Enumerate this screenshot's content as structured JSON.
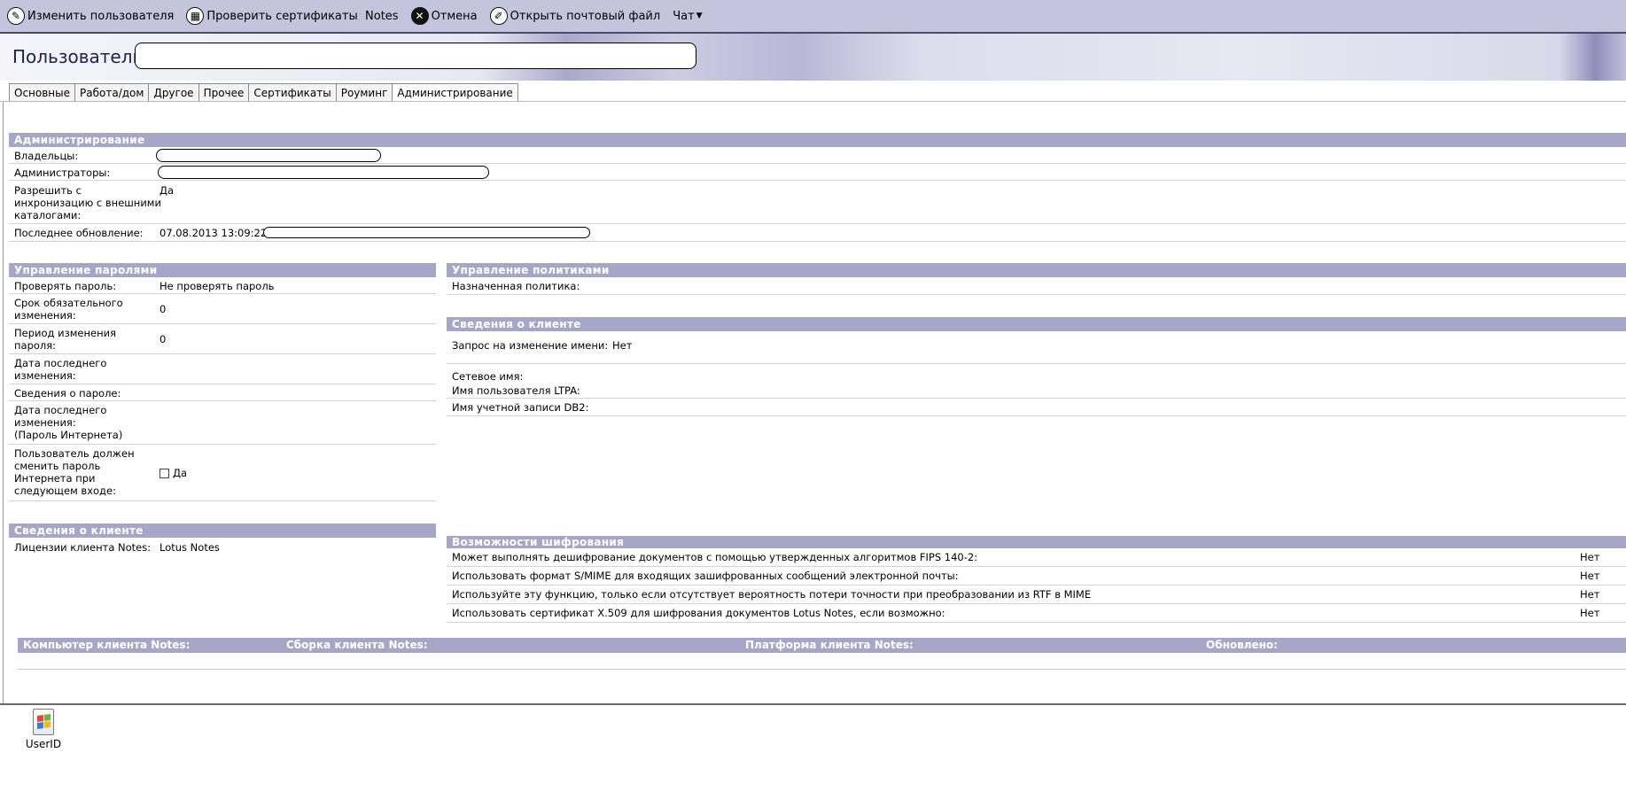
{
  "toolbar": {
    "edit_user": "Изменить пользователя",
    "check_certs": "Проверить сертификаты",
    "check_certs_suffix": "Notes",
    "cancel": "Отмена",
    "open_mail": "Открыть почтовый файл",
    "chat": "Чат"
  },
  "header": {
    "user_label": "Пользователь:",
    "user_value": ""
  },
  "tabs": [
    "Основные",
    "Работа/дом",
    "Другое",
    "Прочее",
    "Сертификаты",
    "Роуминг",
    "Администрирование"
  ],
  "admin": {
    "title": "Администрирование",
    "owners_label": "Владельцы:",
    "admins_label": "Администраторы:",
    "sync_label": "Разрешить синхронизацию с внешними каталогами:",
    "sync_label_lines": [
      "Разрешить с",
      "инхронизацию с внешними",
      "каталогами:"
    ],
    "sync_value": "Да",
    "last_update_label": "Последнее обновление:",
    "last_update_value": "07.08.2013 13:09:22"
  },
  "passwords": {
    "title": "Управление паролями",
    "check_label": "Проверять пароль:",
    "check_value": "Не проверять пароль",
    "required_change_lines": [
      "Срок обязательного",
      "изменения:"
    ],
    "required_change_value": "0",
    "change_period_lines": [
      "Период изменения",
      "пароля:"
    ],
    "change_period_value": "0",
    "last_change_lines": [
      "Дата последнего",
      "изменения:"
    ],
    "password_info_label": "Сведения о пароле:",
    "last_change_internet_lines": [
      "Дата последнего",
      "изменения:",
      "(Пароль Интернета)"
    ],
    "must_change_lines": [
      "Пользователь должен",
      "сменить пароль",
      "Интернета при",
      "следующем входе:"
    ],
    "must_change_option": "Да"
  },
  "client_left": {
    "title": "Сведения о клиенте",
    "licenses_label": "Лицензии клиента Notes:",
    "licenses_value": "Lotus Notes"
  },
  "policies": {
    "title": "Управление политиками",
    "assigned_label": "Назначенная политика:"
  },
  "client_right": {
    "title": "Сведения о клиенте",
    "rename_label": "Запрос на изменение имени:",
    "rename_value": "Нет",
    "network_name_label": "Сетевое имя:",
    "ltpa_label": "Имя пользователя LTPA:",
    "db2_label": "Имя учетной записи DB2:"
  },
  "encryption": {
    "title": "Возможности шифрования",
    "rows": [
      {
        "label": "Может выполнять дешифрование документов с помощью утвержденных алгоритмов FIPS 140-2:",
        "value": "Нет"
      },
      {
        "label": "Использовать формат S/MIME для входящих зашифрованных сообщений электронной почты:",
        "value": "Нет"
      },
      {
        "label": "Используйте эту функцию, только если отсутствует вероятность потери точности при преобразовании из RTF в MIME",
        "value": "Нет"
      },
      {
        "label": "Использовать сертификат X.509 для шифрования документов Lotus Notes, если возможно:",
        "value": "Нет"
      }
    ]
  },
  "client_table": {
    "col_computer": "Компьютер клиента Notes:",
    "col_build": "Сборка клиента Notes:",
    "col_platform": "Платформа клиента Notes:",
    "col_updated": "Обновлено:"
  },
  "attachment": {
    "label": "UserID"
  },
  "icons": {
    "edit": "pencil-icon",
    "certs": "certificate-icon",
    "cancel": "close-icon",
    "mail": "wrench-icon",
    "chat_caret": "chevron-down-icon",
    "attachment": "userid-file-icon"
  },
  "colors": {
    "section_header": "#a6a6c8",
    "toolbar": "#c4c4dc",
    "header_text": "#22224a"
  }
}
